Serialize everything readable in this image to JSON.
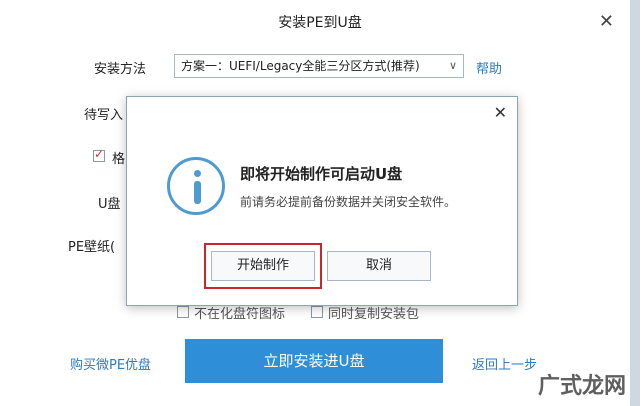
{
  "window": {
    "title": "安装PE到U盘",
    "close_glyph": "✕"
  },
  "form": {
    "method_label": "安装方法",
    "method_value": "方案一：UEFI/Legacy全能三分区方式(推荐)",
    "help_link": "帮助",
    "write_label": "待写入",
    "format_label": "格",
    "udisk_label": "U盘",
    "wallpaper_label": "PE壁纸(",
    "opt_no_format": "不在化盘符图标",
    "opt_copy_pkg": "同时复制安装包"
  },
  "actions": {
    "buy_link": "购买微PE优盘",
    "install_button": "立即安装进U盘",
    "back_link": "返回上一步"
  },
  "dialog": {
    "title": "即将开始制作可启动U盘",
    "subtitle": "前请务必提前备份数据并关闭安全软件。",
    "start_button": "开始制作",
    "cancel_button": "取消",
    "close_glyph": "✕"
  },
  "watermark": "广式龙网"
}
